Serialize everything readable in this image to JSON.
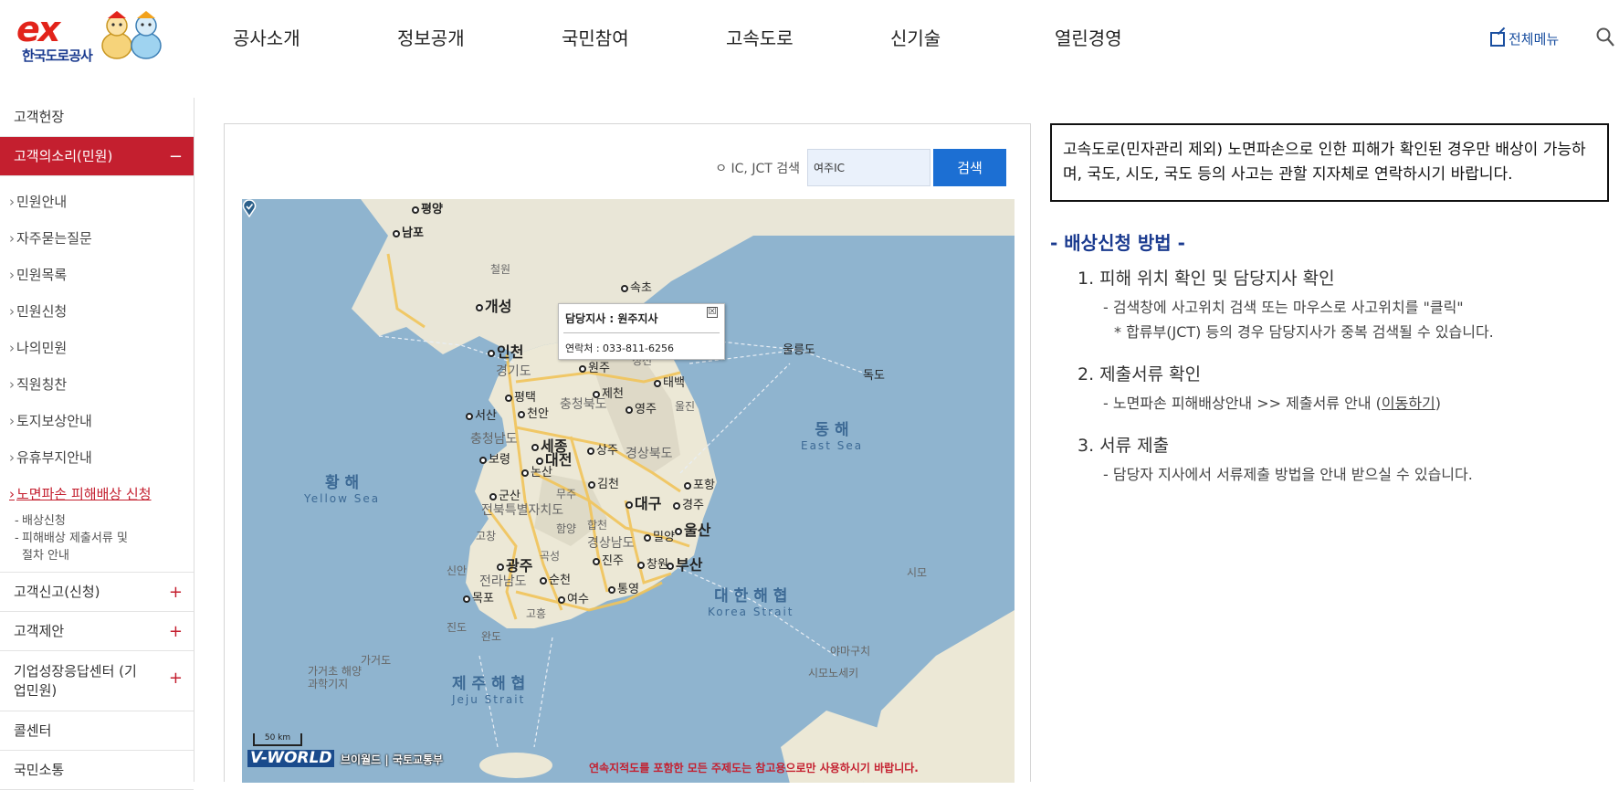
{
  "header": {
    "logo_text": "한국도로공사",
    "logo_mark": "ex",
    "nav": [
      "공사소개",
      "정보공개",
      "국민참여",
      "고속도로",
      "신기술",
      "열린경영"
    ],
    "all_menu": "전체메뉴",
    "icons": {
      "all_menu": "external-link-icon",
      "search": "search-icon"
    }
  },
  "sidebar": {
    "top_item": "고객헌장",
    "active_item": {
      "label": "고객의소리(민원)",
      "sign": "−"
    },
    "sub_items": [
      "민원안내",
      "자주묻는질문",
      "민원목록",
      "민원신청",
      "나의민원",
      "직원칭찬",
      "토지보상안내",
      "유휴부지안내"
    ],
    "current_sub": "노면파손 피해배상 신청",
    "third_items": [
      "배상신청",
      "피해배상 제출서류 및",
      "절차 안내"
    ],
    "items_after": [
      {
        "label": "고객신고(신청)",
        "sign": "+"
      },
      {
        "label": "고객제안",
        "sign": "+"
      },
      {
        "label": "기업성장응답센터 (기업민원)",
        "sign": "+"
      },
      {
        "label": "콜센터",
        "sign": ""
      },
      {
        "label": "국민소통",
        "sign": ""
      }
    ]
  },
  "map_panel": {
    "search_label": "ㅇ IC, JCT 검색",
    "search_value": "여주IC",
    "search_button": "검색",
    "popup": {
      "title": "담당지사 : 원주지사",
      "contact": "연락처 : 033-811-6256",
      "close": "☒"
    },
    "places": [
      "평양",
      "남포",
      "철원",
      "속초",
      "개성",
      "인천",
      "원주",
      "동해",
      "울릉도",
      "독도",
      "경기도",
      "정선",
      "태백",
      "평택",
      "제천",
      "충청북도",
      "영주",
      "울진",
      "서산",
      "천안",
      "세종",
      "충청남도",
      "상주",
      "대전",
      "보령",
      "경상북도",
      "논산",
      "김천",
      "포항",
      "군산",
      "무주",
      "대구",
      "경주",
      "전북특별자치도",
      "합천",
      "밀양",
      "울산",
      "고창",
      "함양",
      "광주",
      "곡성",
      "경상남도",
      "진주",
      "창원",
      "부산",
      "신안",
      "순천",
      "전라남도",
      "목포",
      "여수",
      "통영",
      "고흥",
      "진도",
      "완도",
      "가거도",
      "가거초 해양과학기지",
      "야마구치",
      "시모노세키",
      "시모"
    ],
    "seas": [
      {
        "ko": "황 해",
        "en": "Yellow Sea"
      },
      {
        "ko": "동 해",
        "en": "East Sea"
      },
      {
        "ko": "대 한 해 협",
        "en": "Korea Strait"
      },
      {
        "ko": "제 주 해 협",
        "en": "Jeju Strait"
      }
    ],
    "scale": "50 km",
    "vworld": "V-WORLD",
    "credits": "브이월드 | 국토교통부",
    "disclaimer": "연속지적도를 포함한 모든 주제도는 참고용으로만 사용하시기 바랍니다."
  },
  "notice": "고속도로(민자관리 제외) 노면파손으로 인한 피해가 확인된 경우만 배상이 가능하며, 국도, 시도, 국도 등의 사고는 관할 지자체로 연락하시기 바랍니다.",
  "method": {
    "title": "- 배상신청 방법 -",
    "steps": [
      {
        "title": "1. 피해 위치 확인 및 담당지사 확인",
        "lines": [
          "- 검색창에 사고위치 검색 또는 마우스로 사고위치를 \"클릭\""
        ],
        "note": "* 합류부(JCT) 등의 경우 담당지사가 중복 검색될 수 있습니다."
      },
      {
        "title": "2. 제출서류 확인",
        "lines": [
          "- 노면파손 피해배상안내 >> 제출서류 안내 ("
        ],
        "link": "이동하기",
        "link_after": ")"
      },
      {
        "title": "3. 서류 제출",
        "lines": [
          "- 담당자 지사에서 서류제출 방법을 안내 받으실 수 있습니다."
        ]
      }
    ]
  }
}
